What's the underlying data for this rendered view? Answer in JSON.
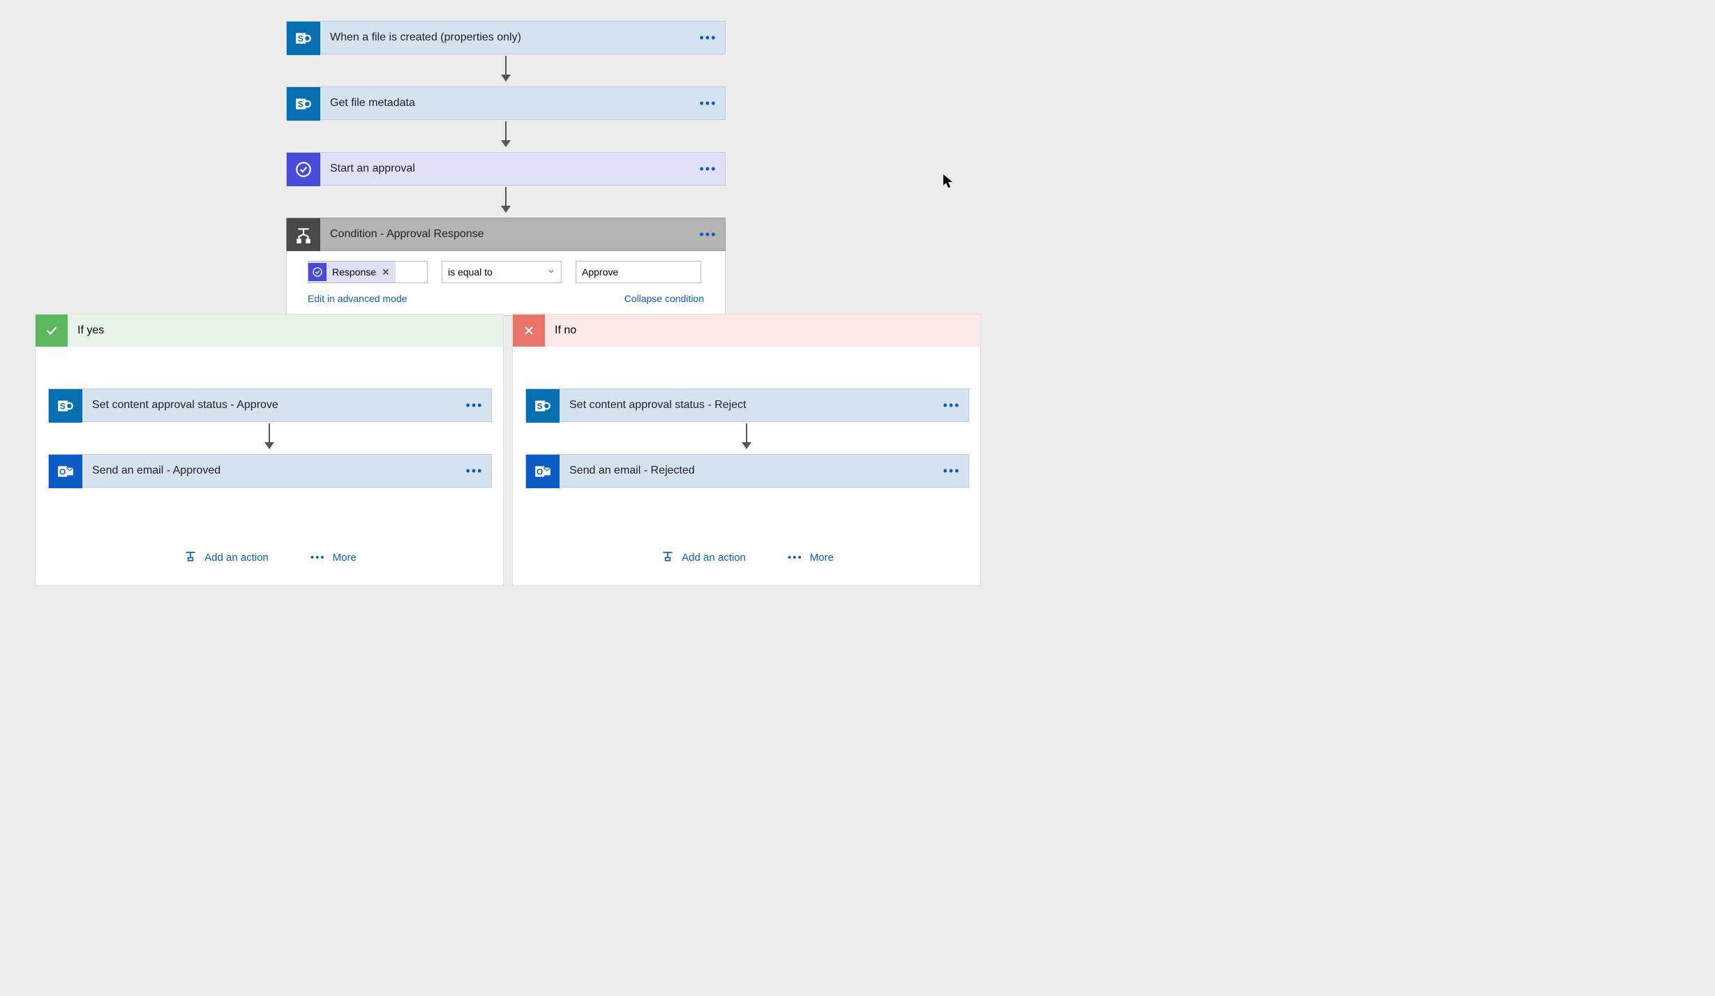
{
  "steps": {
    "trigger": {
      "label": "When a file is created (properties only)"
    },
    "metadata": {
      "label": "Get file metadata"
    },
    "approval": {
      "label": "Start an approval"
    },
    "condition": {
      "label": "Condition - Approval Response"
    }
  },
  "condition": {
    "token_label": "Response",
    "operator": "is equal to",
    "value": "Approve",
    "edit_link": "Edit in advanced mode",
    "collapse_link": "Collapse condition"
  },
  "branches": {
    "yes": {
      "title": "If yes",
      "step1": "Set content approval status - Approve",
      "step2": "Send an email - Approved"
    },
    "no": {
      "title": "If no",
      "step1": "Set content approval status - Reject",
      "step2": "Send an email - Rejected"
    },
    "add_action": "Add an action",
    "more": "More"
  }
}
